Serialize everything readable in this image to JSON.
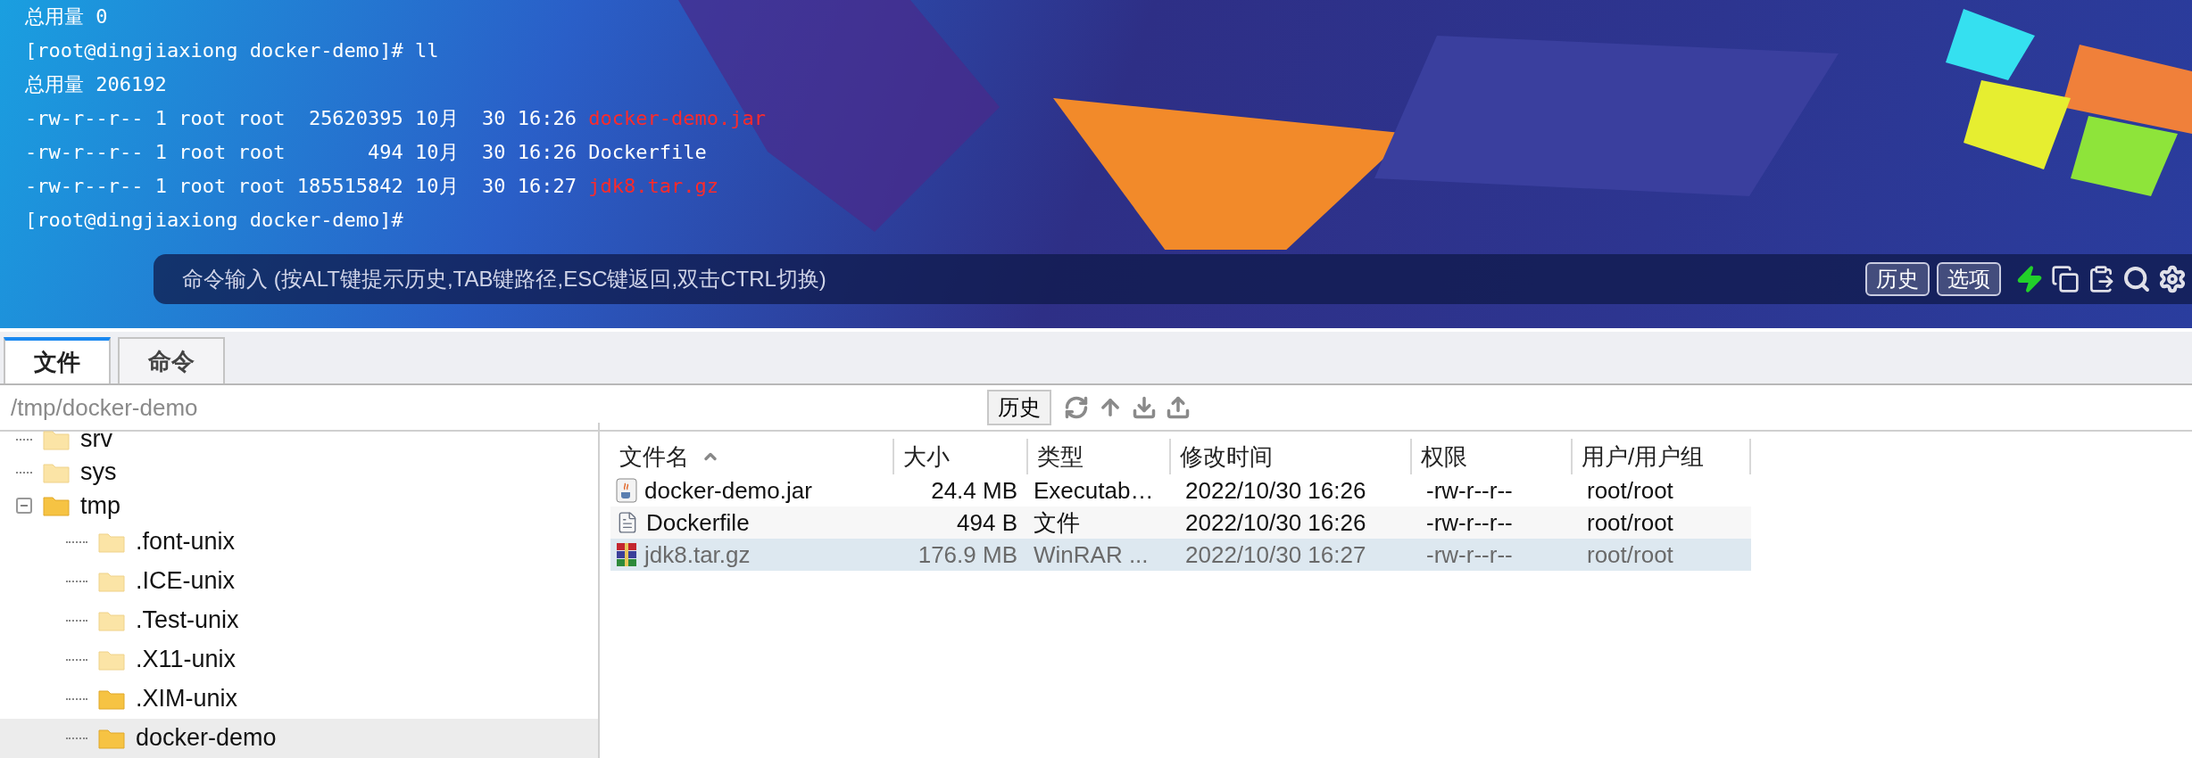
{
  "terminal": {
    "lines": [
      {
        "segments": [
          {
            "text": "总用量 0",
            "highlight": false
          }
        ]
      },
      {
        "segments": [
          {
            "text": "[root@dingjiaxiong docker-demo]# ll",
            "highlight": false
          }
        ]
      },
      {
        "segments": [
          {
            "text": "总用量 206192",
            "highlight": false
          }
        ]
      },
      {
        "segments": [
          {
            "text": "-rw-r--r-- 1 root root  25620395 10月  30 16:26 ",
            "highlight": false
          },
          {
            "text": "docker-demo.jar",
            "highlight": true
          }
        ]
      },
      {
        "segments": [
          {
            "text": "-rw-r--r-- 1 root root       494 10月  30 16:26 ",
            "highlight": false
          },
          {
            "text": "Dockerfile",
            "highlight": false
          }
        ]
      },
      {
        "segments": [
          {
            "text": "-rw-r--r-- 1 root root 185515842 10月  30 16:27 ",
            "highlight": false
          },
          {
            "text": "jdk8.tar.gz",
            "highlight": true
          }
        ]
      },
      {
        "segments": [
          {
            "text": "[root@dingjiaxiong docker-demo]#",
            "highlight": false
          }
        ]
      }
    ]
  },
  "command_bar": {
    "placeholder": "命令输入 (按ALT键提示历史,TAB键路径,ESC键返回,双击CTRL切换)",
    "buttons": [
      "历史",
      "选项"
    ]
  },
  "tabs": [
    {
      "label": "文件",
      "selected": true
    },
    {
      "label": "命令",
      "selected": false
    }
  ],
  "path_bar": {
    "value": "/tmp/docker-demo",
    "history_button": "历史"
  },
  "tree": [
    {
      "label": "srv",
      "expanded": false,
      "selected": false,
      "open_folder": false
    },
    {
      "label": "sys",
      "expanded": false,
      "selected": false,
      "open_folder": false
    },
    {
      "label": "tmp",
      "expanded": true,
      "selected": false,
      "open_folder": true,
      "children": [
        {
          "label": ".font-unix",
          "selected": false,
          "open_folder": false
        },
        {
          "label": ".ICE-unix",
          "selected": false,
          "open_folder": false
        },
        {
          "label": ".Test-unix",
          "selected": false,
          "open_folder": false
        },
        {
          "label": ".X11-unix",
          "selected": false,
          "open_folder": false
        },
        {
          "label": ".XIM-unix",
          "selected": false,
          "open_folder": true
        },
        {
          "label": "docker-demo",
          "selected": true,
          "open_folder": true
        }
      ]
    }
  ],
  "table": {
    "columns": [
      "文件名",
      "大小",
      "类型",
      "修改时间",
      "权限",
      "用户/用户组"
    ],
    "rows": [
      {
        "kind": "jar",
        "selected": false,
        "cells": [
          "docker-demo.jar",
          "24.4 MB",
          "Executab…",
          "2022/10/30 16:26",
          "-rw-r--r--",
          "root/root"
        ]
      },
      {
        "kind": "file",
        "selected": false,
        "cells": [
          "Dockerfile",
          "494 B",
          "文件",
          "2022/10/30 16:26",
          "-rw-r--r--",
          "root/root"
        ]
      },
      {
        "kind": "archive",
        "selected": true,
        "cells": [
          "jdk8.tar.gz",
          "176.9 MB",
          "WinRAR ...",
          "2022/10/30 16:27",
          "-rw-r--r--",
          "root/root"
        ]
      }
    ]
  }
}
